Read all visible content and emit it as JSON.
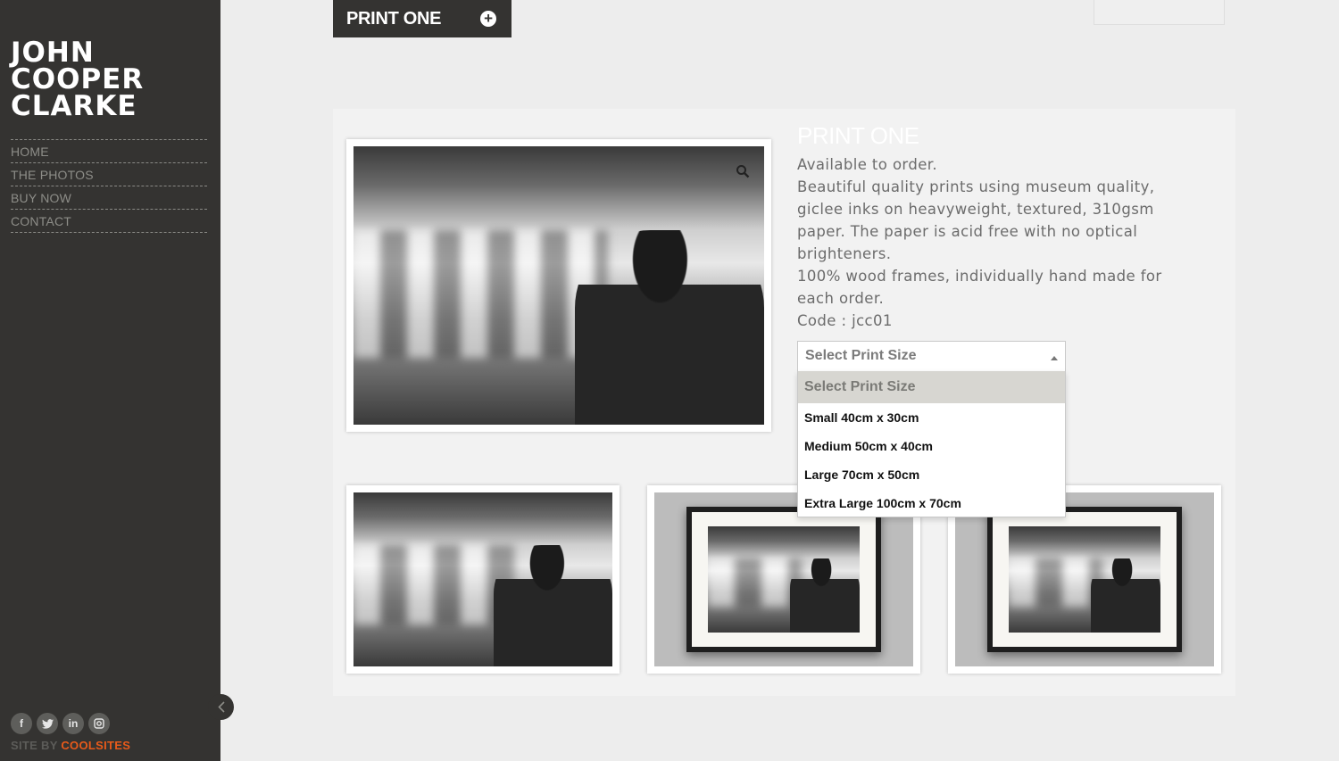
{
  "sidebar": {
    "logo": [
      "JOHN",
      "COOPER",
      "CLARKE"
    ],
    "nav": [
      "HOME",
      "THE PHOTOS",
      "BUY NOW",
      "CONTACT"
    ],
    "social": [
      "facebook-icon",
      "twitter-icon",
      "linkedin-icon",
      "instagram-icon"
    ],
    "credit_prefix": "SITE BY ",
    "credit_brand": "COOLSITES"
  },
  "header": {
    "tab_label": "PRINT ONE"
  },
  "product": {
    "title": "PRINT ONE",
    "description": [
      "Available to order.",
      "Beautiful quality prints using museum quality, giclee inks on heavyweight, textured, 310gsm paper. The paper is acid free with no optical brighteners.",
      "100%  wood frames,  individually hand made for each order.",
      "Code : jcc01"
    ]
  },
  "select": {
    "current": "Select Print Size",
    "options": [
      "Select Print Size",
      "Small 40cm x 30cm",
      "Medium 50cm x 40cm",
      "Large 70cm x 50cm",
      "Extra Large 100cm x 70cm"
    ]
  },
  "colors": {
    "sidebar": "#343331",
    "accent": "#e85a1a",
    "background": "#ededed"
  }
}
